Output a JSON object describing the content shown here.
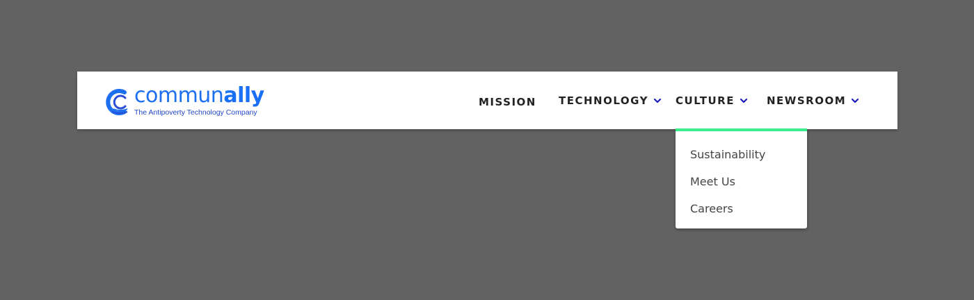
{
  "brand": {
    "name_light": "commun",
    "name_bold": "ally",
    "tagline": "The Antipoverty Technology Company",
    "color": "#1d6ff2"
  },
  "nav": {
    "items": [
      {
        "label": "MISSION",
        "has_dropdown": false
      },
      {
        "label": "TECHNOLOGY",
        "has_dropdown": true
      },
      {
        "label": "CULTURE",
        "has_dropdown": true,
        "expanded": true
      },
      {
        "label": "NEWSROOM",
        "has_dropdown": true
      }
    ],
    "chevron_color": "#1a1ab8"
  },
  "dropdown": {
    "parent": "CULTURE",
    "accent_color": "#38f08a",
    "items": [
      {
        "label": "Sustainability"
      },
      {
        "label": "Meet Us"
      },
      {
        "label": "Careers"
      }
    ]
  },
  "icons": [
    "logo-c-wave-icon",
    "chevron-down-icon"
  ],
  "colors": {
    "background": "#626262",
    "navbar": "#ffffff",
    "nav_text": "#222222"
  }
}
